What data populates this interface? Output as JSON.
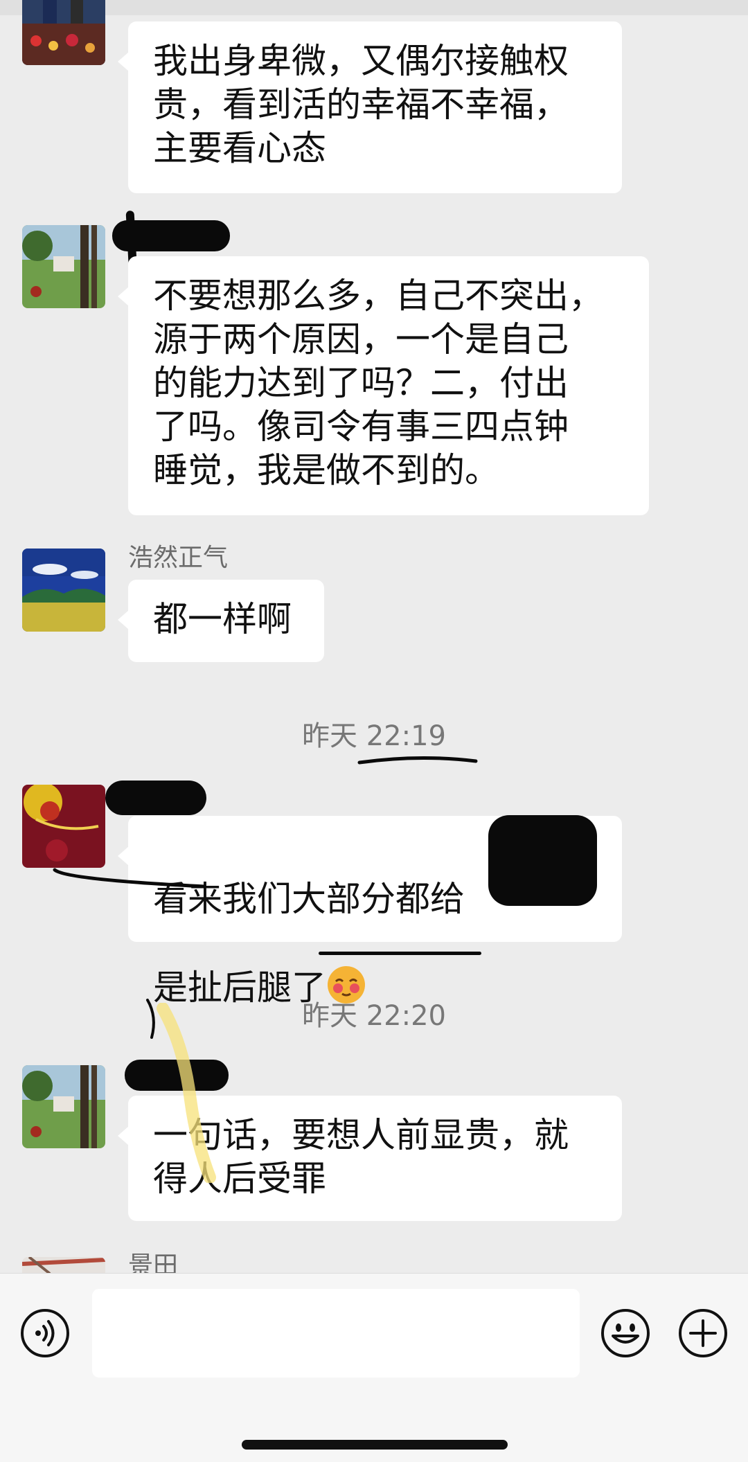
{
  "messages": [
    {
      "text": "我出身卑微，又偶尔接触权\n贵，看到活的幸福不幸福，\n主要看心态"
    },
    {
      "text": "不要想那么多，自己不突出，\n源于两个原因，一个是自己\n的能力达到了吗？二，付出\n了吗。像司令有事三四点钟\n睡觉，我是做不到的。"
    },
    {
      "sender": "浩然正气",
      "text": "都一样啊"
    },
    {
      "text_line1": "看来我们大部分都给",
      "text_line2": "是扯后腿了"
    },
    {
      "text": "一句话，要想人前显贵，就\n得人后受罪"
    },
    {
      "sender": "景田"
    }
  ],
  "timestamps": [
    "昨天 22:19",
    "昨天 22:20"
  ],
  "input": {
    "value": ""
  },
  "icons": {
    "voice": "voice-icon",
    "emoji": "emoji-smile-icon",
    "plus": "plus-icon",
    "blush": "blushing-face-emoji"
  },
  "colors": {
    "chat_background": "#ececec",
    "bubble": "#ffffff",
    "input_bar": "#f6f6f6"
  }
}
